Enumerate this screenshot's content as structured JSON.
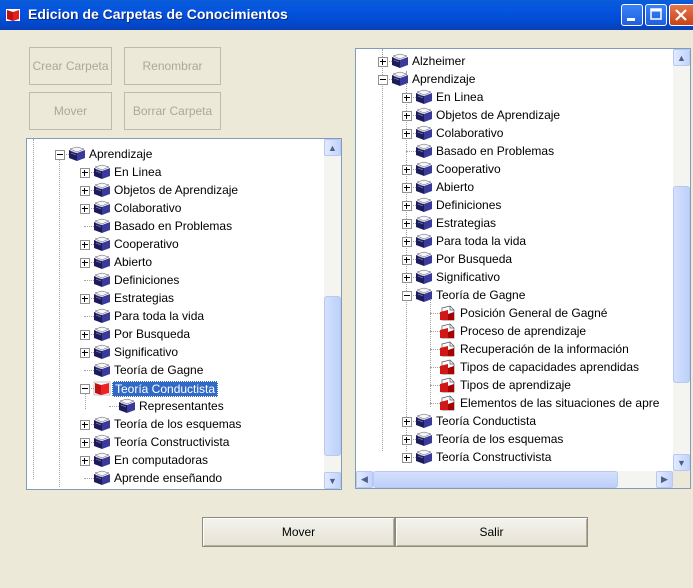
{
  "window": {
    "title": "Edicion de Carpetas de Conocimientos"
  },
  "toolbar": {
    "crear_carpeta": "Crear Carpeta",
    "renombrar": "Renombrar",
    "mover": "Mover",
    "borrar_carpeta": "Borrar Carpeta"
  },
  "left_tree": {
    "items": [
      {
        "label": "Aprendizaje",
        "expander": "minus",
        "icon": "folder-books"
      },
      {
        "label": "En Linea",
        "expander": "plus",
        "icon": "folder-books"
      },
      {
        "label": "Objetos de Aprendizaje",
        "expander": "plus",
        "icon": "folder-books"
      },
      {
        "label": "Colaborativo",
        "expander": "plus",
        "icon": "folder-books"
      },
      {
        "label": "Basado en Problemas",
        "expander": "none",
        "icon": "folder-books"
      },
      {
        "label": "Cooperativo",
        "expander": "plus",
        "icon": "folder-books"
      },
      {
        "label": "Abierto",
        "expander": "plus",
        "icon": "folder-books"
      },
      {
        "label": "Definiciones",
        "expander": "none",
        "icon": "folder-books"
      },
      {
        "label": "Estrategias",
        "expander": "plus",
        "icon": "folder-books"
      },
      {
        "label": "Para toda la vida",
        "expander": "none",
        "icon": "folder-books"
      },
      {
        "label": "Por Busqueda",
        "expander": "plus",
        "icon": "folder-books"
      },
      {
        "label": "Significativo",
        "expander": "plus",
        "icon": "folder-books"
      },
      {
        "label": "Teoría de Gagne",
        "expander": "none",
        "icon": "folder-books"
      },
      {
        "label": "Teoría Conductista",
        "expander": "minus",
        "icon": "open-red-folder",
        "selected": true
      },
      {
        "label": "Representantes",
        "expander": "none",
        "icon": "folder-books"
      },
      {
        "label": "Teoría de los esquemas",
        "expander": "plus",
        "icon": "folder-books"
      },
      {
        "label": "Teoría Constructivista",
        "expander": "plus",
        "icon": "folder-books"
      },
      {
        "label": "En computadoras",
        "expander": "plus",
        "icon": "folder-books"
      },
      {
        "label": "Aprende enseñando",
        "expander": "none",
        "icon": "folder-books"
      }
    ]
  },
  "right_tree": {
    "items": [
      {
        "label": "Alzheimer",
        "expander": "plus",
        "icon": "folder-books"
      },
      {
        "label": "Aprendizaje",
        "expander": "minus",
        "icon": "folder-books"
      },
      {
        "label": "En Linea",
        "expander": "plus",
        "icon": "folder-books"
      },
      {
        "label": "Objetos de Aprendizaje",
        "expander": "plus",
        "icon": "folder-books"
      },
      {
        "label": "Colaborativo",
        "expander": "plus",
        "icon": "folder-books"
      },
      {
        "label": "Basado en Problemas",
        "expander": "none",
        "icon": "folder-books"
      },
      {
        "label": "Cooperativo",
        "expander": "plus",
        "icon": "folder-books"
      },
      {
        "label": "Abierto",
        "expander": "plus",
        "icon": "folder-books"
      },
      {
        "label": "Definiciones",
        "expander": "plus",
        "icon": "folder-books"
      },
      {
        "label": "Estrategias",
        "expander": "plus",
        "icon": "folder-books"
      },
      {
        "label": "Para toda la vida",
        "expander": "plus",
        "icon": "folder-books"
      },
      {
        "label": "Por Busqueda",
        "expander": "plus",
        "icon": "folder-books"
      },
      {
        "label": "Significativo",
        "expander": "plus",
        "icon": "folder-books"
      },
      {
        "label": "Teoría de Gagne",
        "expander": "minus",
        "icon": "folder-books"
      },
      {
        "label": "Posición General de Gagné",
        "expander": "none",
        "icon": "document-red"
      },
      {
        "label": "Proceso de aprendizaje",
        "expander": "none",
        "icon": "document-red"
      },
      {
        "label": "Recuperación de la información",
        "expander": "none",
        "icon": "document-red"
      },
      {
        "label": "Tipos de capacidades aprendidas",
        "expander": "none",
        "icon": "document-red"
      },
      {
        "label": "Tipos de aprendizaje",
        "expander": "none",
        "icon": "document-red"
      },
      {
        "label": "Elementos de las situaciones de apre",
        "expander": "none",
        "icon": "document-red"
      },
      {
        "label": "Teoría Conductista",
        "expander": "plus",
        "icon": "folder-books"
      },
      {
        "label": "Teoría de los esquemas",
        "expander": "plus",
        "icon": "folder-books"
      },
      {
        "label": "Teoría Constructivista",
        "expander": "plus",
        "icon": "folder-books"
      }
    ]
  },
  "footer": {
    "mover": "Mover",
    "salir": "Salir"
  }
}
